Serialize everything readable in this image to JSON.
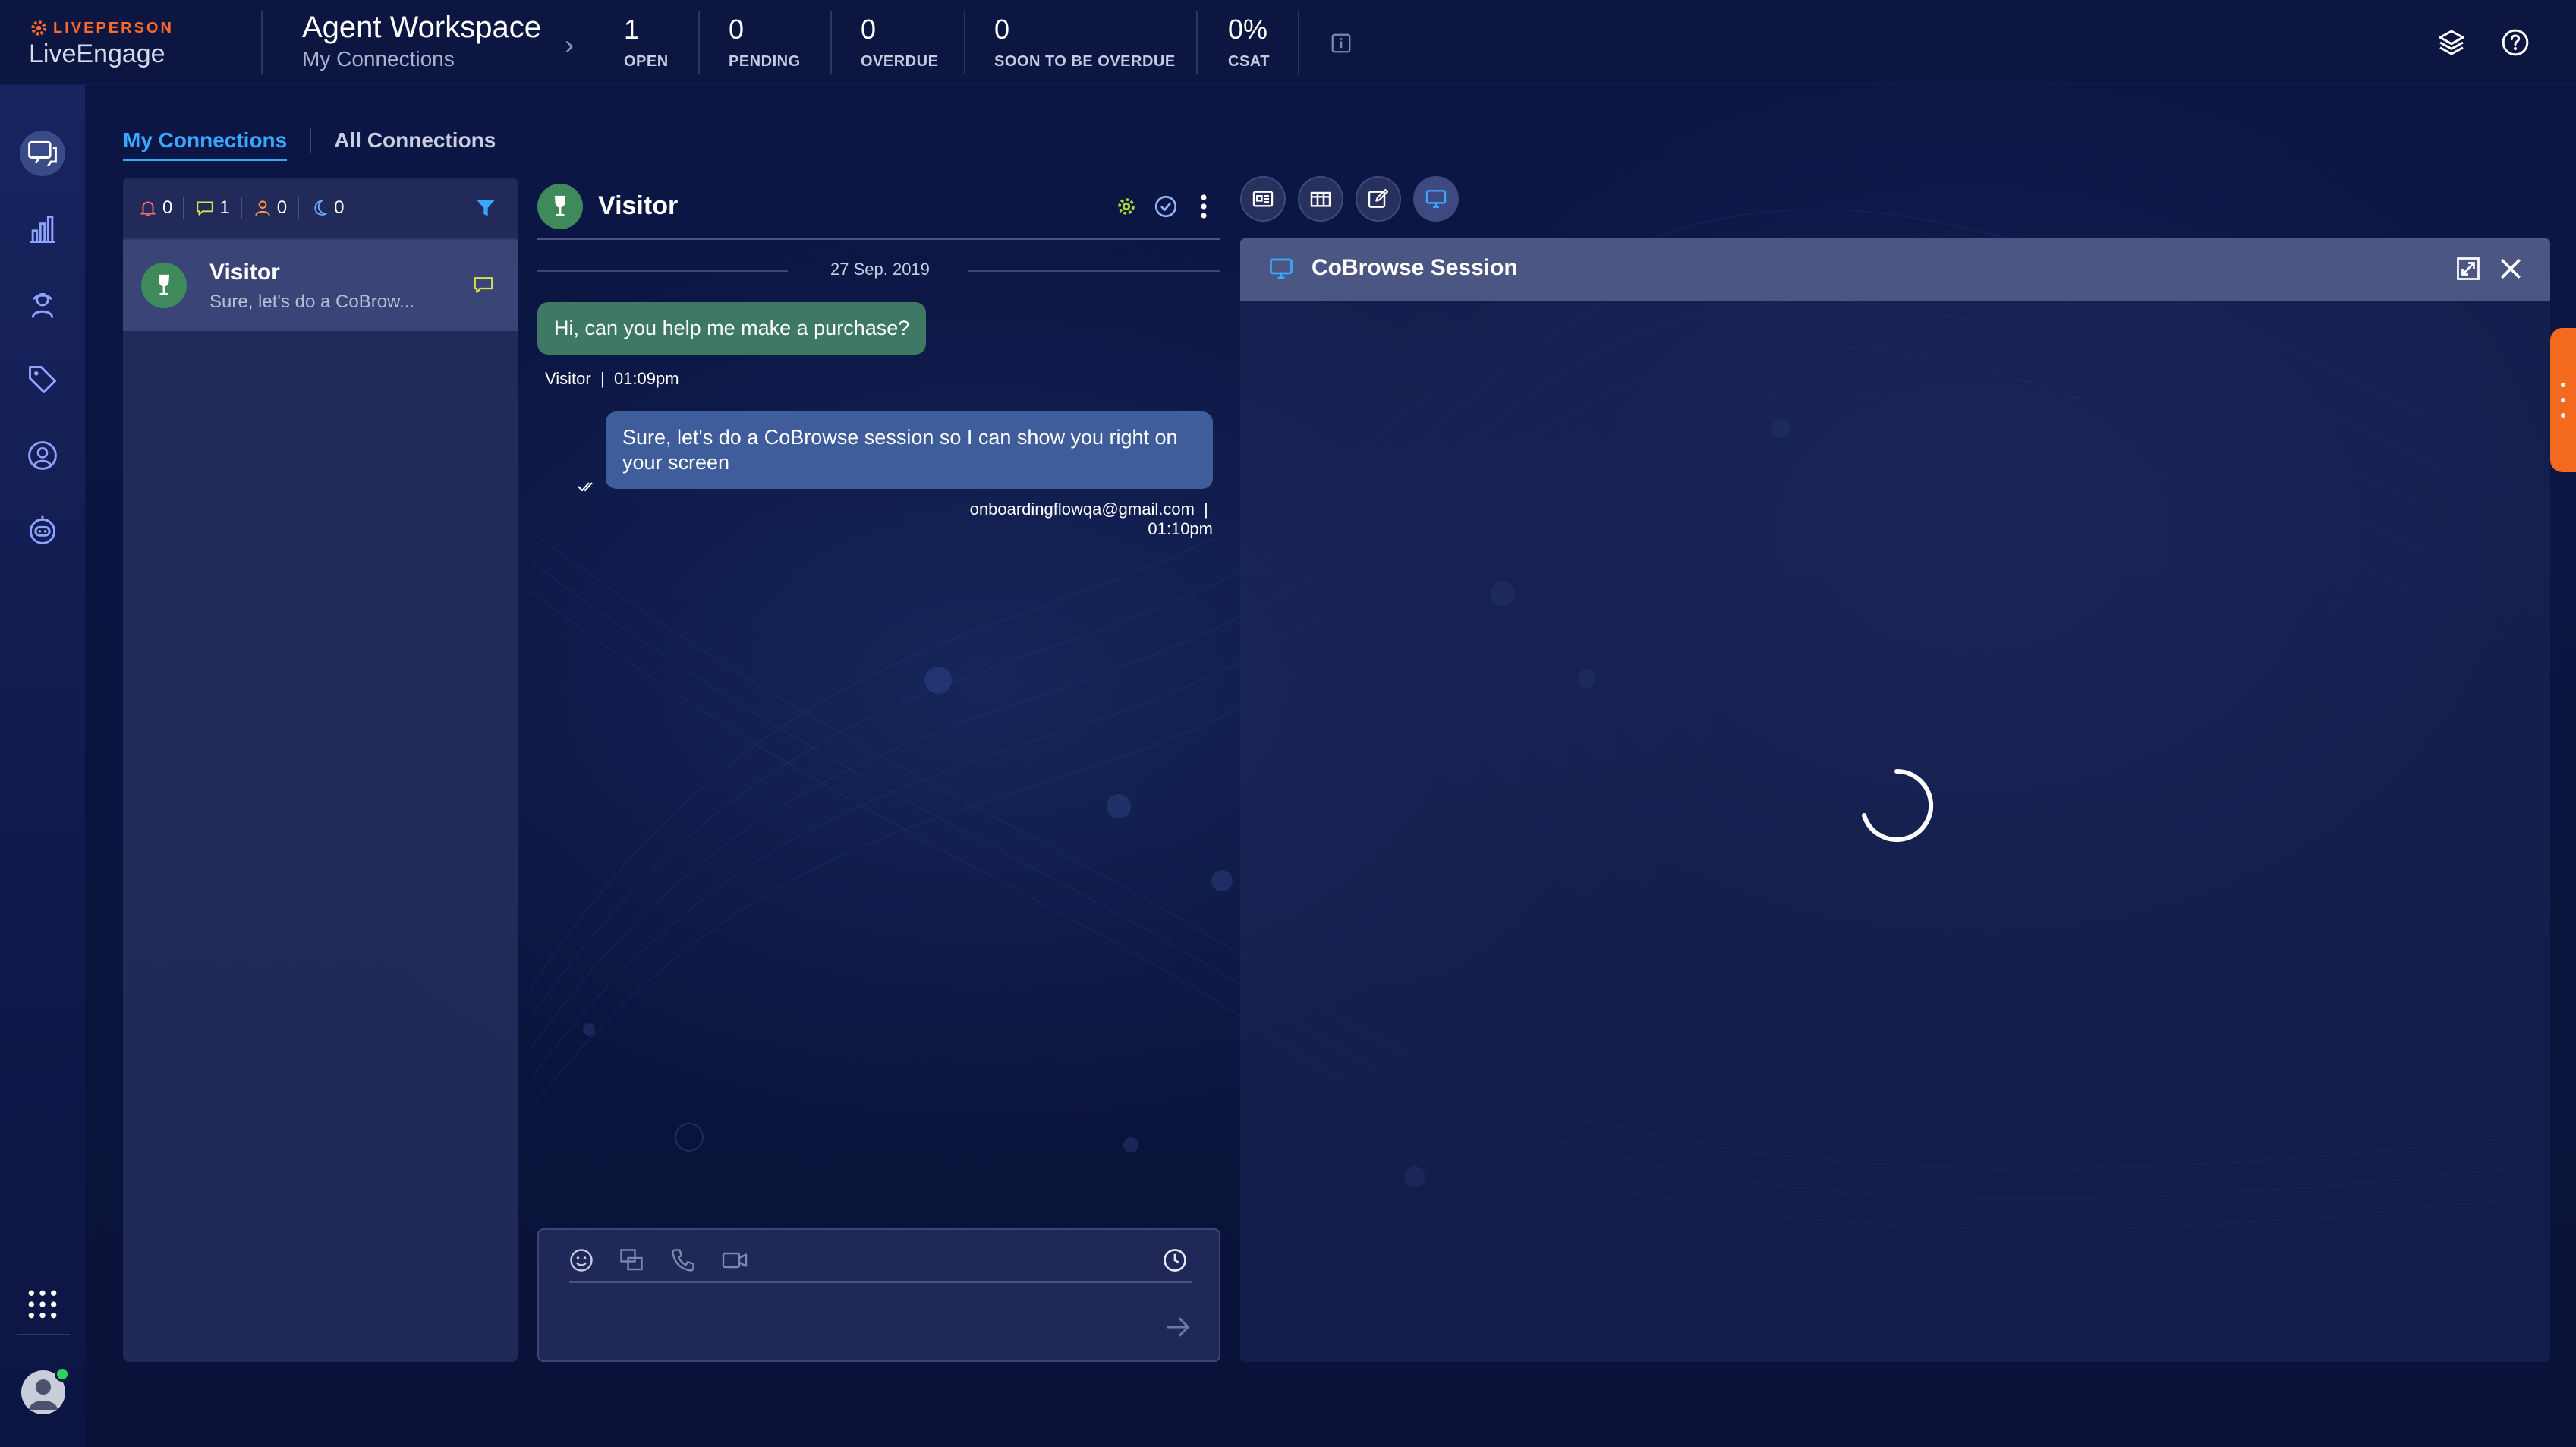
{
  "brand": {
    "company": "LIVEPERSON",
    "product": "LiveEngage",
    "accent": "#ff6a2b"
  },
  "workspace": {
    "title": "Agent Workspace",
    "subtitle": "My Connections"
  },
  "stats": [
    {
      "value": "1",
      "label": "OPEN"
    },
    {
      "value": "0",
      "label": "PENDING"
    },
    {
      "value": "0",
      "label": "OVERDUE"
    },
    {
      "value": "0",
      "label": "SOON TO BE OVERDUE"
    },
    {
      "value": "0%",
      "label": "CSAT"
    }
  ],
  "topbar_icons": [
    "info-icon",
    "layers-icon",
    "help-icon"
  ],
  "rail": {
    "items": [
      "conversations-icon",
      "analytics-icon",
      "agent-icon",
      "tag-icon",
      "contacts-icon",
      "bot-icon"
    ],
    "bottom": [
      "apps-grid-icon",
      "user-avatar"
    ],
    "status_color": "#2fd35a"
  },
  "tabs": [
    {
      "label": "My Connections",
      "active": true
    },
    {
      "label": "All Connections",
      "active": false
    }
  ],
  "list": {
    "counters": [
      {
        "icon": "bell-icon",
        "value": "0"
      },
      {
        "icon": "chat-icon",
        "value": "1"
      },
      {
        "icon": "person-icon",
        "value": "0"
      },
      {
        "icon": "moon-icon",
        "value": "0"
      }
    ],
    "rows": [
      {
        "name": "Visitor",
        "snippet": "Sure, let's do a CoBrow..."
      }
    ]
  },
  "chat": {
    "visitor_name": "Visitor",
    "date": "27 Sep. 2019",
    "messages": [
      {
        "from": "visitor",
        "text": "Hi, can you help me make a purchase?",
        "sender": "Visitor",
        "time": "01:09pm"
      },
      {
        "from": "agent",
        "text": "Sure, let's do a CoBrowse session so I can show you right on your screen",
        "sender": "onboardingflowqa@gmail.com",
        "time": "01:10pm"
      }
    ],
    "composer": {
      "placeholder": "",
      "tools": [
        "emoji-icon",
        "canned-response-icon",
        "phone-icon",
        "video-icon",
        "clock-icon"
      ]
    }
  },
  "widgets": {
    "tools": [
      "consumer-info-icon",
      "transcript-icon",
      "notes-icon",
      "cobrowse-icon"
    ],
    "active": "cobrowse-icon"
  },
  "cobrowse": {
    "title": "CoBrowse Session",
    "loading": true
  }
}
